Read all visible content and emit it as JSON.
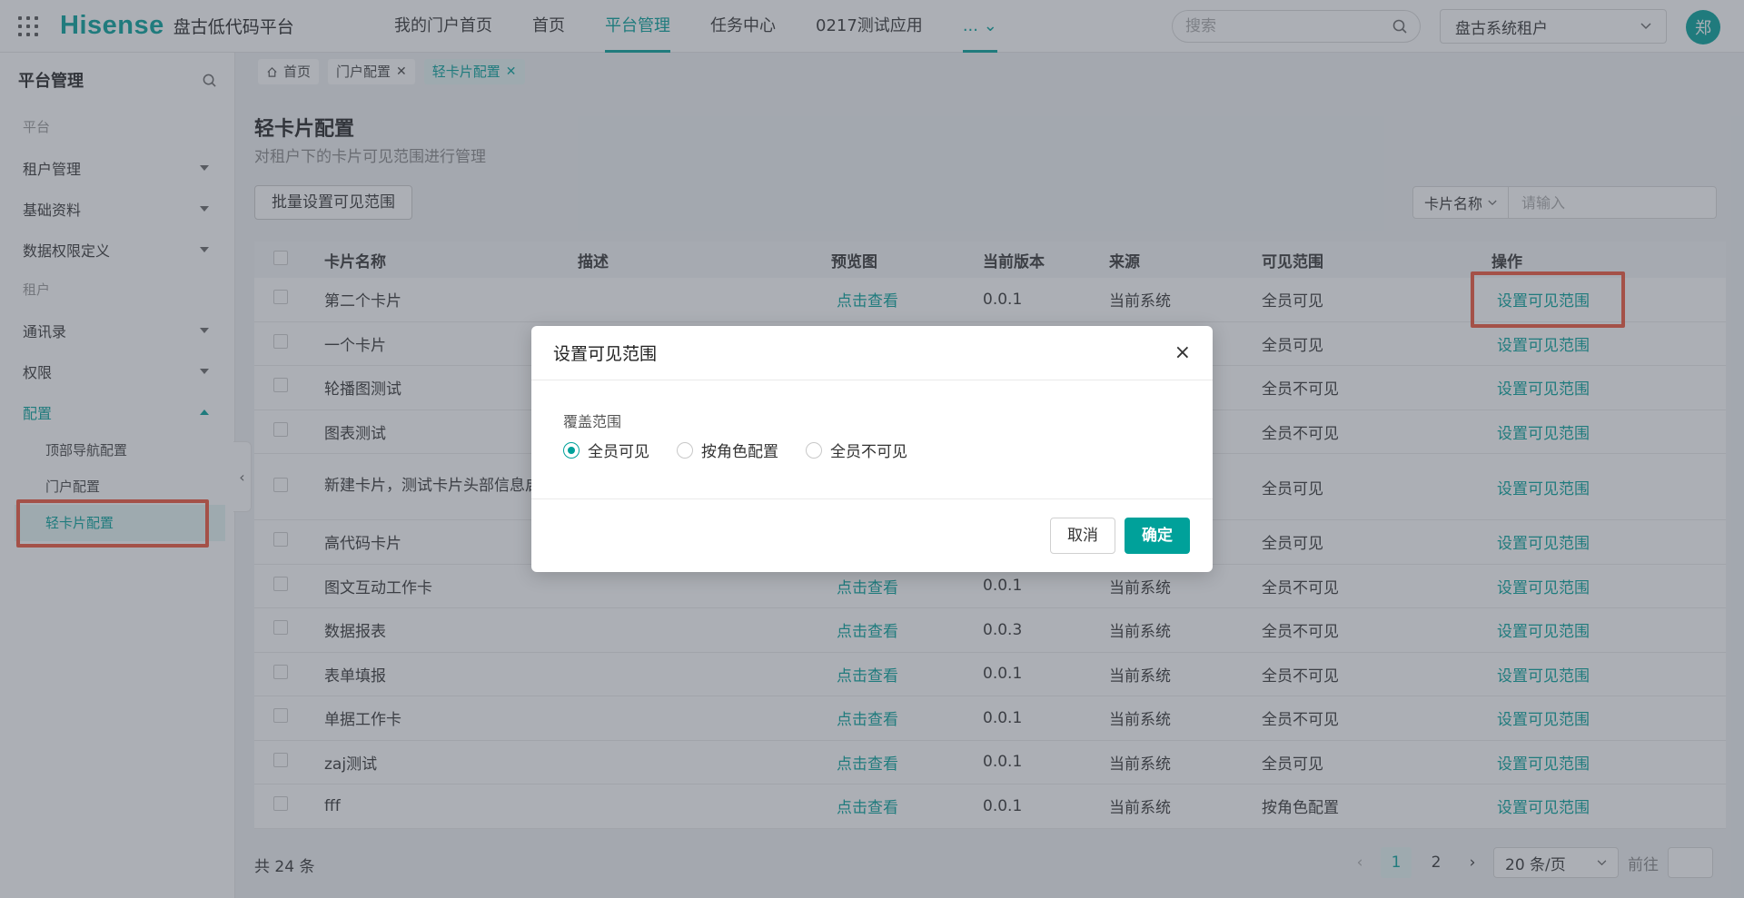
{
  "topbar": {
    "logo": "Hisense",
    "platform_name": "盘古低代码平台",
    "nav": [
      {
        "label": "我的门户首页"
      },
      {
        "label": "首页"
      },
      {
        "label": "平台管理"
      },
      {
        "label": "任务中心"
      },
      {
        "label": "0217测试应用"
      },
      {
        "label": "... ⌄"
      }
    ],
    "search_placeholder": "搜索",
    "tenant": "盘古系统租户",
    "avatar": "郑"
  },
  "sidebar": {
    "title": "平台管理",
    "group_platform": "平台",
    "items_platform": [
      {
        "label": "租户管理"
      },
      {
        "label": "基础资料"
      },
      {
        "label": "数据权限定义"
      }
    ],
    "group_tenant": "租户",
    "items_tenant": [
      {
        "label": "通讯录"
      },
      {
        "label": "权限"
      }
    ],
    "config_label": "配置",
    "config_children": [
      {
        "label": "顶部导航配置"
      },
      {
        "label": "门户配置"
      },
      {
        "label": "轻卡片配置"
      }
    ]
  },
  "tabs": [
    {
      "label": "首页"
    },
    {
      "label": "门户配置"
    },
    {
      "label": "轻卡片配置"
    }
  ],
  "page": {
    "title": "轻卡片配置",
    "subtitle": "对租户下的卡片可见范围进行管理",
    "batch_button": "批量设置可见范围",
    "filter_field": "卡片名称",
    "filter_placeholder": "请输入"
  },
  "table": {
    "headers": [
      "卡片名称",
      "描述",
      "预览图",
      "当前版本",
      "来源",
      "可见范围",
      "操作"
    ],
    "rows": [
      {
        "name": "第二个卡片",
        "desc": "",
        "preview": "点击查看",
        "version": "0.0.1",
        "source": "当前系统",
        "scope": "全员可见",
        "action": "设置可见范围"
      },
      {
        "name": "一个卡片",
        "desc": "",
        "preview": "",
        "version": "",
        "source": "",
        "scope": "全员可见",
        "action": "设置可见范围"
      },
      {
        "name": "轮播图测试",
        "desc": "",
        "preview": "",
        "version": "",
        "source": "",
        "scope": "全员不可见",
        "action": "设置可见范围"
      },
      {
        "name": "图表测试",
        "desc": "",
        "preview": "",
        "version": "",
        "source": "",
        "scope": "全员不可见",
        "action": "设置可见范围"
      },
      {
        "name": "新建卡片，测试卡片头部信息启迪",
        "desc": "",
        "preview": "",
        "version": "",
        "source": "",
        "scope": "全员可见",
        "action": "设置可见范围"
      },
      {
        "name": "高代码卡片",
        "desc": "",
        "preview": "",
        "version": "",
        "source": "",
        "scope": "全员可见",
        "action": "设置可见范围"
      },
      {
        "name": "图文互动工作卡",
        "desc": "",
        "preview": "点击查看",
        "version": "0.0.1",
        "source": "当前系统",
        "scope": "全员不可见",
        "action": "设置可见范围"
      },
      {
        "name": "数据报表",
        "desc": "",
        "preview": "点击查看",
        "version": "0.0.3",
        "source": "当前系统",
        "scope": "全员不可见",
        "action": "设置可见范围"
      },
      {
        "name": "表单填报",
        "desc": "",
        "preview": "点击查看",
        "version": "0.0.1",
        "source": "当前系统",
        "scope": "全员不可见",
        "action": "设置可见范围"
      },
      {
        "name": "单据工作卡",
        "desc": "",
        "preview": "点击查看",
        "version": "0.0.1",
        "source": "当前系统",
        "scope": "全员不可见",
        "action": "设置可见范围"
      },
      {
        "name": "zaj测试",
        "desc": "",
        "preview": "点击查看",
        "version": "0.0.1",
        "source": "当前系统",
        "scope": "全员可见",
        "action": "设置可见范围"
      },
      {
        "name": "fff",
        "desc": "",
        "preview": "点击查看",
        "version": "0.0.1",
        "source": "当前系统",
        "scope": "按角色配置",
        "action": "设置可见范围"
      }
    ]
  },
  "pagination": {
    "total": "共 24 条",
    "pages": [
      "1",
      "2"
    ],
    "current": "1",
    "page_size": "20 条/页",
    "goto_label": "前往"
  },
  "modal": {
    "title": "设置可见范围",
    "field_label": "覆盖范围",
    "options": [
      {
        "label": "全员可见",
        "selected": true
      },
      {
        "label": "按角色配置",
        "selected": false
      },
      {
        "label": "全员不可见",
        "selected": false
      }
    ],
    "cancel": "取消",
    "confirm": "确定"
  },
  "colors": {
    "accent": "#00a19a",
    "highlight": "#f0553a"
  },
  "icons": [
    "apps-grid-icon",
    "search-icon",
    "chevron-down-icon",
    "home-icon",
    "close-icon",
    "chevron-left-icon",
    "chevron-right-icon"
  ]
}
